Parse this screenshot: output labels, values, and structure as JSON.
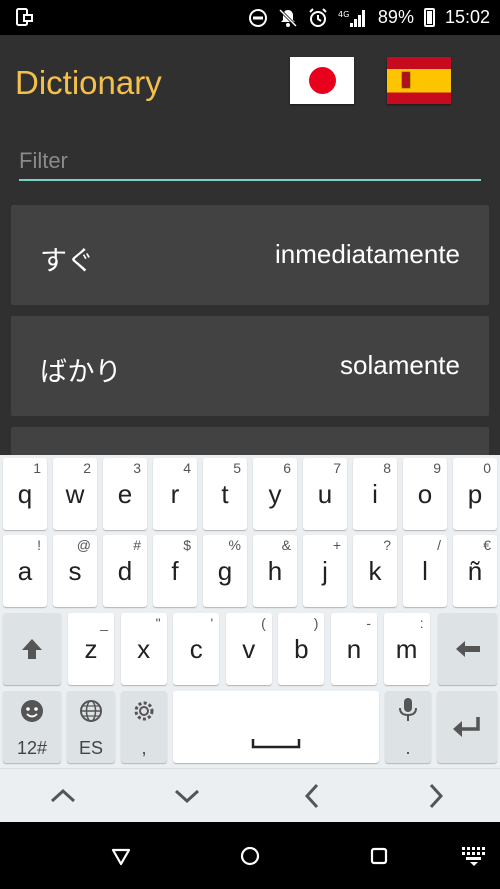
{
  "status_bar": {
    "battery": "89%",
    "time": "15:02",
    "icons": [
      "screenshot-icon",
      "dnd-icon",
      "notifications-off-icon",
      "alarm-icon",
      "4g-icon",
      "signal-icon",
      "battery-icon"
    ]
  },
  "app": {
    "title": "Dictionary",
    "flags": [
      "japan-flag",
      "spain-flag"
    ],
    "filter_placeholder": "Filter",
    "entries": [
      {
        "japanese": "すぐ",
        "spanish": "inmediatamente"
      },
      {
        "japanese": "ばかり",
        "spanish": "solamente"
      }
    ],
    "colors": {
      "title": "#f5c04a",
      "accent": "#7ccfc4",
      "background": "#303030",
      "card": "#424242"
    }
  },
  "keyboard": {
    "row1": [
      {
        "k": "q",
        "h": "1"
      },
      {
        "k": "w",
        "h": "2"
      },
      {
        "k": "e",
        "h": "3"
      },
      {
        "k": "r",
        "h": "4"
      },
      {
        "k": "t",
        "h": "5"
      },
      {
        "k": "y",
        "h": "6"
      },
      {
        "k": "u",
        "h": "7"
      },
      {
        "k": "i",
        "h": "8"
      },
      {
        "k": "o",
        "h": "9"
      },
      {
        "k": "p",
        "h": "0"
      }
    ],
    "row2": [
      {
        "k": "a",
        "h": "!"
      },
      {
        "k": "s",
        "h": "@"
      },
      {
        "k": "d",
        "h": "#"
      },
      {
        "k": "f",
        "h": "$"
      },
      {
        "k": "g",
        "h": "%"
      },
      {
        "k": "h",
        "h": "&"
      },
      {
        "k": "j",
        "h": "+"
      },
      {
        "k": "k",
        "h": "?"
      },
      {
        "k": "l",
        "h": "/"
      },
      {
        "k": "ñ",
        "h": "€"
      }
    ],
    "row3": [
      {
        "k": "z",
        "h": "_"
      },
      {
        "k": "x",
        "h": "\""
      },
      {
        "k": "c",
        "h": "'"
      },
      {
        "k": "v",
        "h": "("
      },
      {
        "k": "b",
        "h": ")"
      },
      {
        "k": "n",
        "h": "-"
      },
      {
        "k": "m",
        "h": ":"
      }
    ],
    "symbols_label": "12#",
    "language_label": "ES",
    "comma_label": ",",
    "period_label": "."
  }
}
